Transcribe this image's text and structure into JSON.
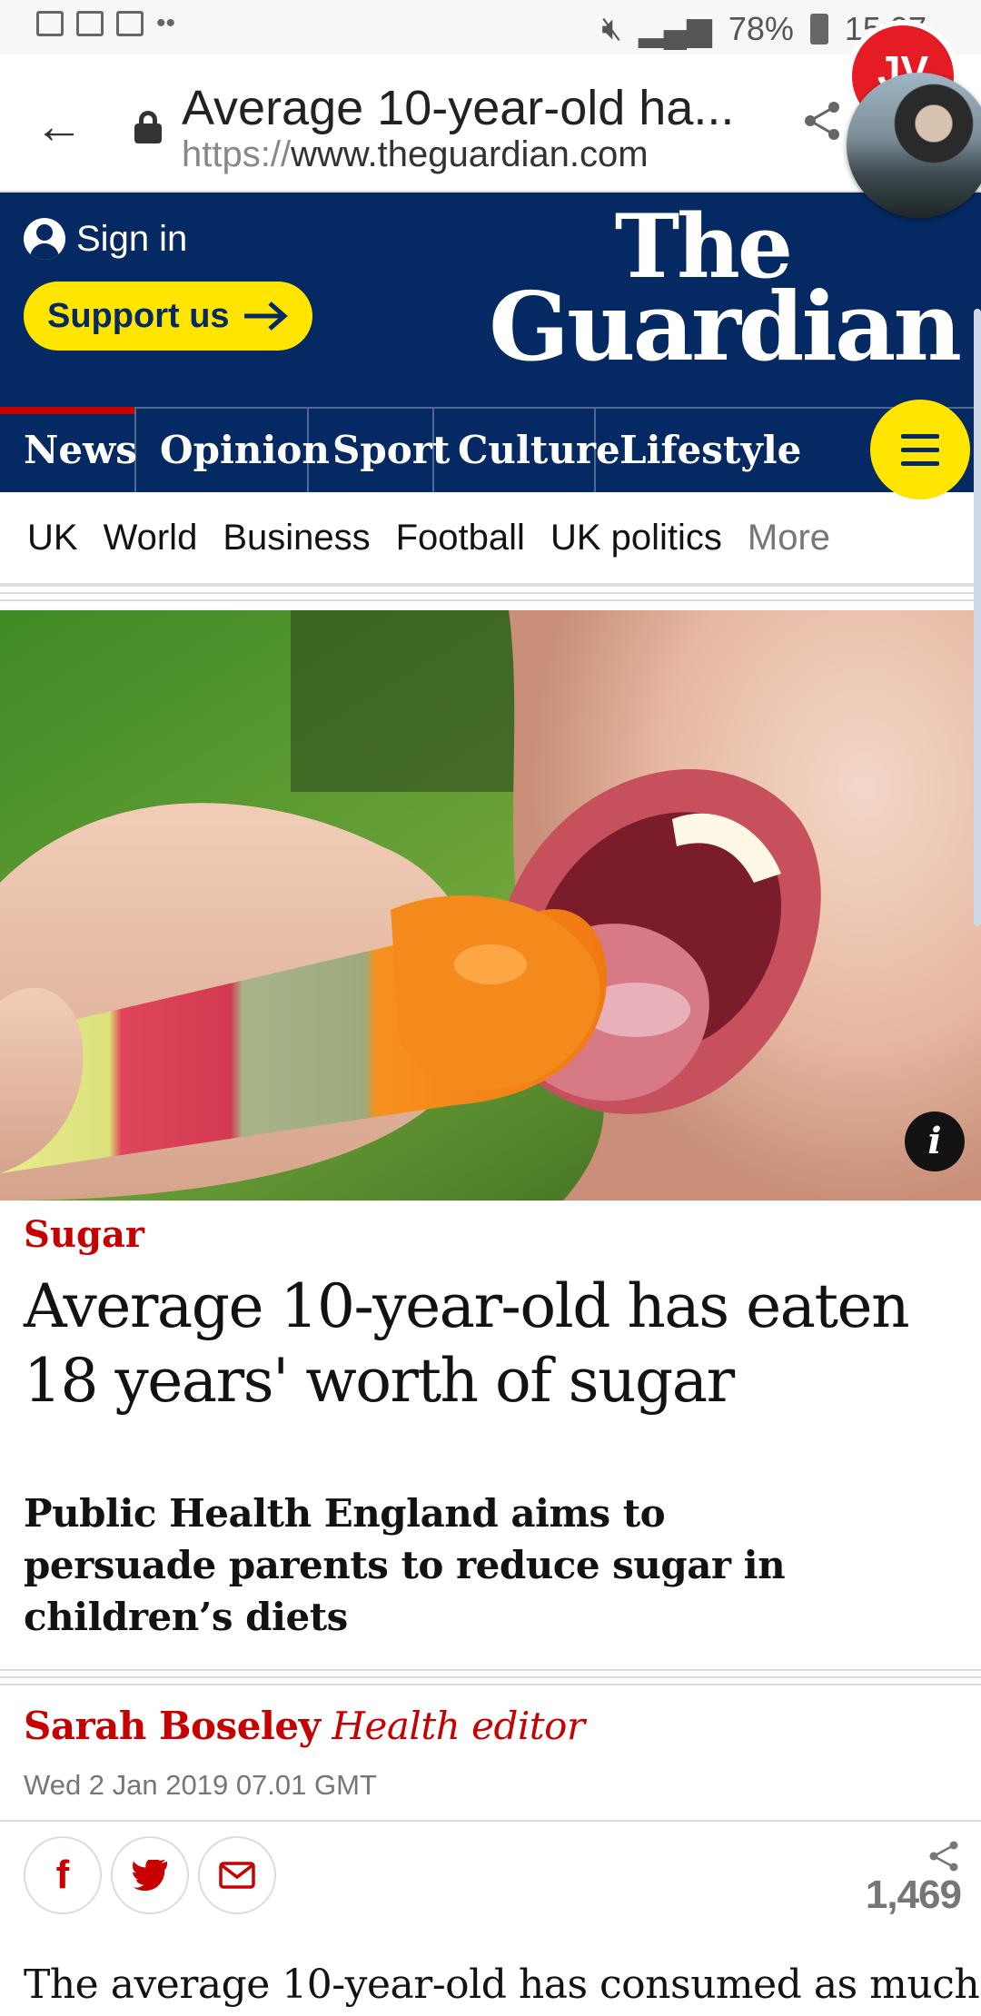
{
  "status_bar": {
    "battery": "78%",
    "time": "15:07"
  },
  "browser": {
    "page_title": "Average 10-year-old ha...",
    "url_scheme": "https://",
    "url_host": "www.theguardian.com",
    "avatar_badge": "JV"
  },
  "header": {
    "sign_in": "Sign in",
    "support": "Support us",
    "logo_line1": "The",
    "logo_line2": "Guardian"
  },
  "pillars": [
    "News",
    "Opinion",
    "Sport",
    "Culture",
    "Lifestyle"
  ],
  "subnav": [
    "UK",
    "World",
    "Business",
    "Football",
    "UK politics",
    "More"
  ],
  "article": {
    "kicker": "Sugar",
    "headline": "Average 10-year-old has eaten 18 years' worth of sugar",
    "standfirst": "Public Health England aims to persuade parents to reduce sugar in children’s diets",
    "author": "Sarah Boseley",
    "author_role": "Health editor",
    "date": "Wed 2 Jan 2019 07.01 GMT",
    "share_count": "1,469",
    "body_first_line": "The average 10-year-old has consumed as much"
  },
  "colors": {
    "brand_navy": "#052962",
    "support_yellow": "#ffe500",
    "news_red": "#c70000"
  }
}
